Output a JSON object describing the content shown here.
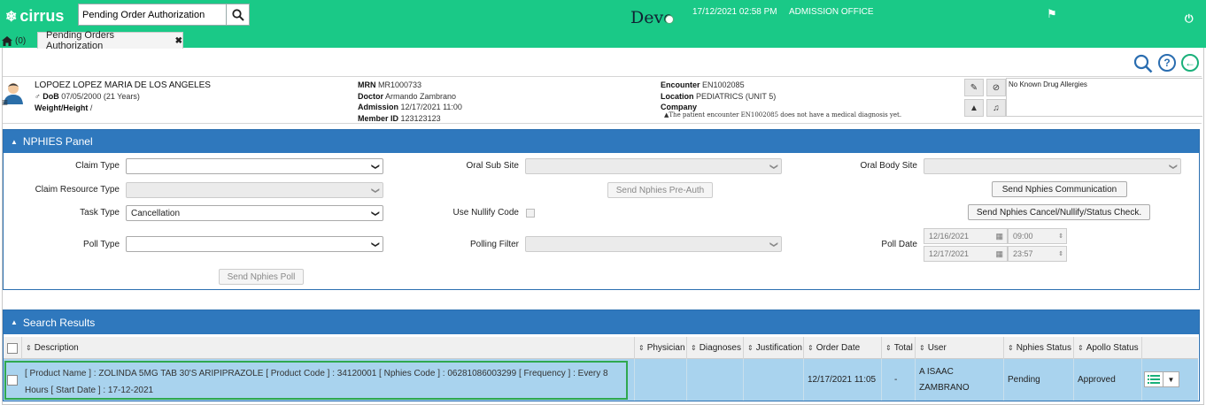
{
  "topbar": {
    "logo": "cirrus",
    "search_value": "Pending Order Authorization",
    "environment": "Devo",
    "datetime": "17/12/2021 02:58 PM",
    "location": "ADMISSION OFFICE",
    "icons": [
      "search-icon",
      "flag-icon",
      "power-icon"
    ]
  },
  "tabs": {
    "home_label": "(0)",
    "active_tab": "Pending Orders Authorization"
  },
  "patient": {
    "name": "LOPOEZ LOPEZ MARIA DE LOS ANGELES",
    "dob_label": "DoB",
    "dob_value": "07/05/2000 (21 Years)",
    "weight_label": "Weight/Height",
    "weight_value": "/",
    "mrn_label": "MRN",
    "mrn": "MR1000733",
    "doctor_label": "Doctor",
    "doctor": "Armando Zambrano",
    "admission_label": "Admission",
    "admission": "12/17/2021 11:00",
    "member_label": "Member ID",
    "member_id": "123123123",
    "encounter_label": "Encounter",
    "encounter": "EN1002085",
    "location_label": "Location",
    "location": "PEDIATRICS (UNIT 5)",
    "company_label": "Company",
    "company": "",
    "warning": "The patient encounter EN1002085 does not have a medical diagnosis yet.",
    "allergies": "No Known Drug Allergies"
  },
  "nphies": {
    "title": "NPHIES Panel",
    "claim_type_label": "Claim Type",
    "claim_type": "",
    "claim_resource_label": "Claim Resource Type",
    "claim_resource": "",
    "task_type_label": "Task Type",
    "task_type": "Cancellation",
    "poll_type_label": "Poll Type",
    "poll_type": "",
    "oral_sub_site_label": "Oral Sub Site",
    "oral_sub_site": "",
    "use_nullify_label": "Use Nullify Code",
    "polling_filter_label": "Polling Filter",
    "polling_filter": "",
    "oral_body_site_label": "Oral Body Site",
    "oral_body_site": "",
    "poll_date_label": "Poll Date",
    "poll_date_from": "12/16/2021",
    "poll_time_from": "09:00",
    "poll_date_to": "12/17/2021",
    "poll_time_to": "23:57",
    "btn_preauth": "Send Nphies Pre-Auth",
    "btn_communication": "Send Nphies Communication",
    "btn_cancel": "Send Nphies Cancel/Nullify/Status Check.",
    "btn_poll": "Send Nphies Poll"
  },
  "results": {
    "title": "Search Results",
    "columns": [
      "Description",
      "Physician",
      "Diagnoses",
      "Justification",
      "Order Date",
      "Total",
      "User",
      "Nphies Status",
      "Apollo Status"
    ],
    "rows": [
      {
        "description": "[ Product Name ] : ZOLINDA 5MG TAB 30'S ARIPIPRAZOLE [ Product Code ] : 34120001 [ Nphies Code ] : 06281086003299 [ Frequency ] : Every 8 Hours [ Start Date ] : 17-12-2021",
        "physician": "",
        "diagnoses": "",
        "justification": "",
        "order_date": "12/17/2021 11:05",
        "total": "-",
        "user": "A ISAAC ZAMBRANO",
        "nphies_status": "Pending",
        "apollo_status": "Approved"
      }
    ]
  },
  "colors": {
    "topbar": "#1ac987",
    "panel_header": "#2f78bd",
    "row_selected": "#a9d3ee",
    "row_outline": "#2fa84f"
  }
}
